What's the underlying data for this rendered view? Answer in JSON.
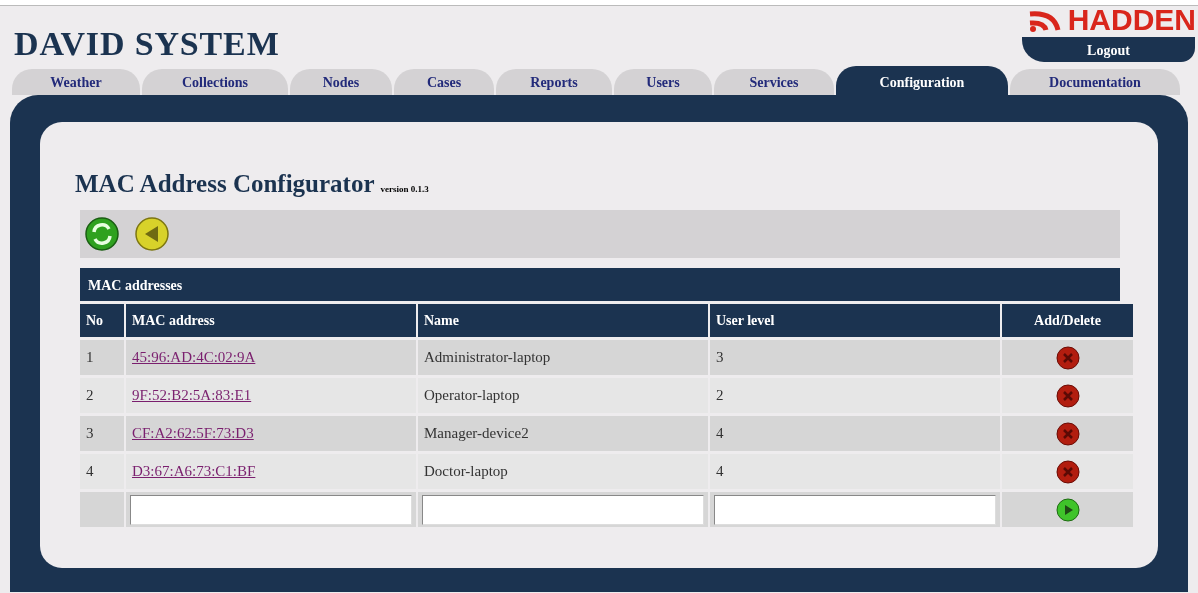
{
  "header": {
    "title": "DAVID SYSTEM",
    "logo": "HADDEN",
    "logout": "Logout"
  },
  "tabs": [
    {
      "label": "Weather",
      "selected": false
    },
    {
      "label": "Collections",
      "selected": false
    },
    {
      "label": "Nodes",
      "selected": false
    },
    {
      "label": "Cases",
      "selected": false
    },
    {
      "label": "Reports",
      "selected": false
    },
    {
      "label": "Users",
      "selected": false
    },
    {
      "label": "Services",
      "selected": false
    },
    {
      "label": "Configuration",
      "selected": true
    },
    {
      "label": "Documentation",
      "selected": false
    }
  ],
  "page": {
    "title": "MAC Address Configurator",
    "version": "version 0.1.3"
  },
  "toolbar": [
    {
      "kind": "refresh"
    },
    {
      "kind": "back"
    }
  ],
  "table": {
    "caption": "MAC addresses",
    "columns": [
      "No",
      "MAC address",
      "Name",
      "User level",
      "Add/Delete"
    ],
    "rows": [
      {
        "no": "1",
        "mac": "45:96:AD:4C:02:9A",
        "name": "Administrator-laptop",
        "level_text": "3"
      },
      {
        "no": "2",
        "mac": "9F:52:B2:5A:83:E1",
        "name": "Operator-laptop",
        "level_text": "2"
      },
      {
        "no": "3",
        "mac": "CF:A2:62:5F:73:D3",
        "name": "Manager-device2",
        "level_text": "4"
      },
      {
        "no": "4",
        "mac": "D3:67:A6:73:C1:BF",
        "name": "Doctor-laptop",
        "level_text": "4"
      }
    ]
  }
}
